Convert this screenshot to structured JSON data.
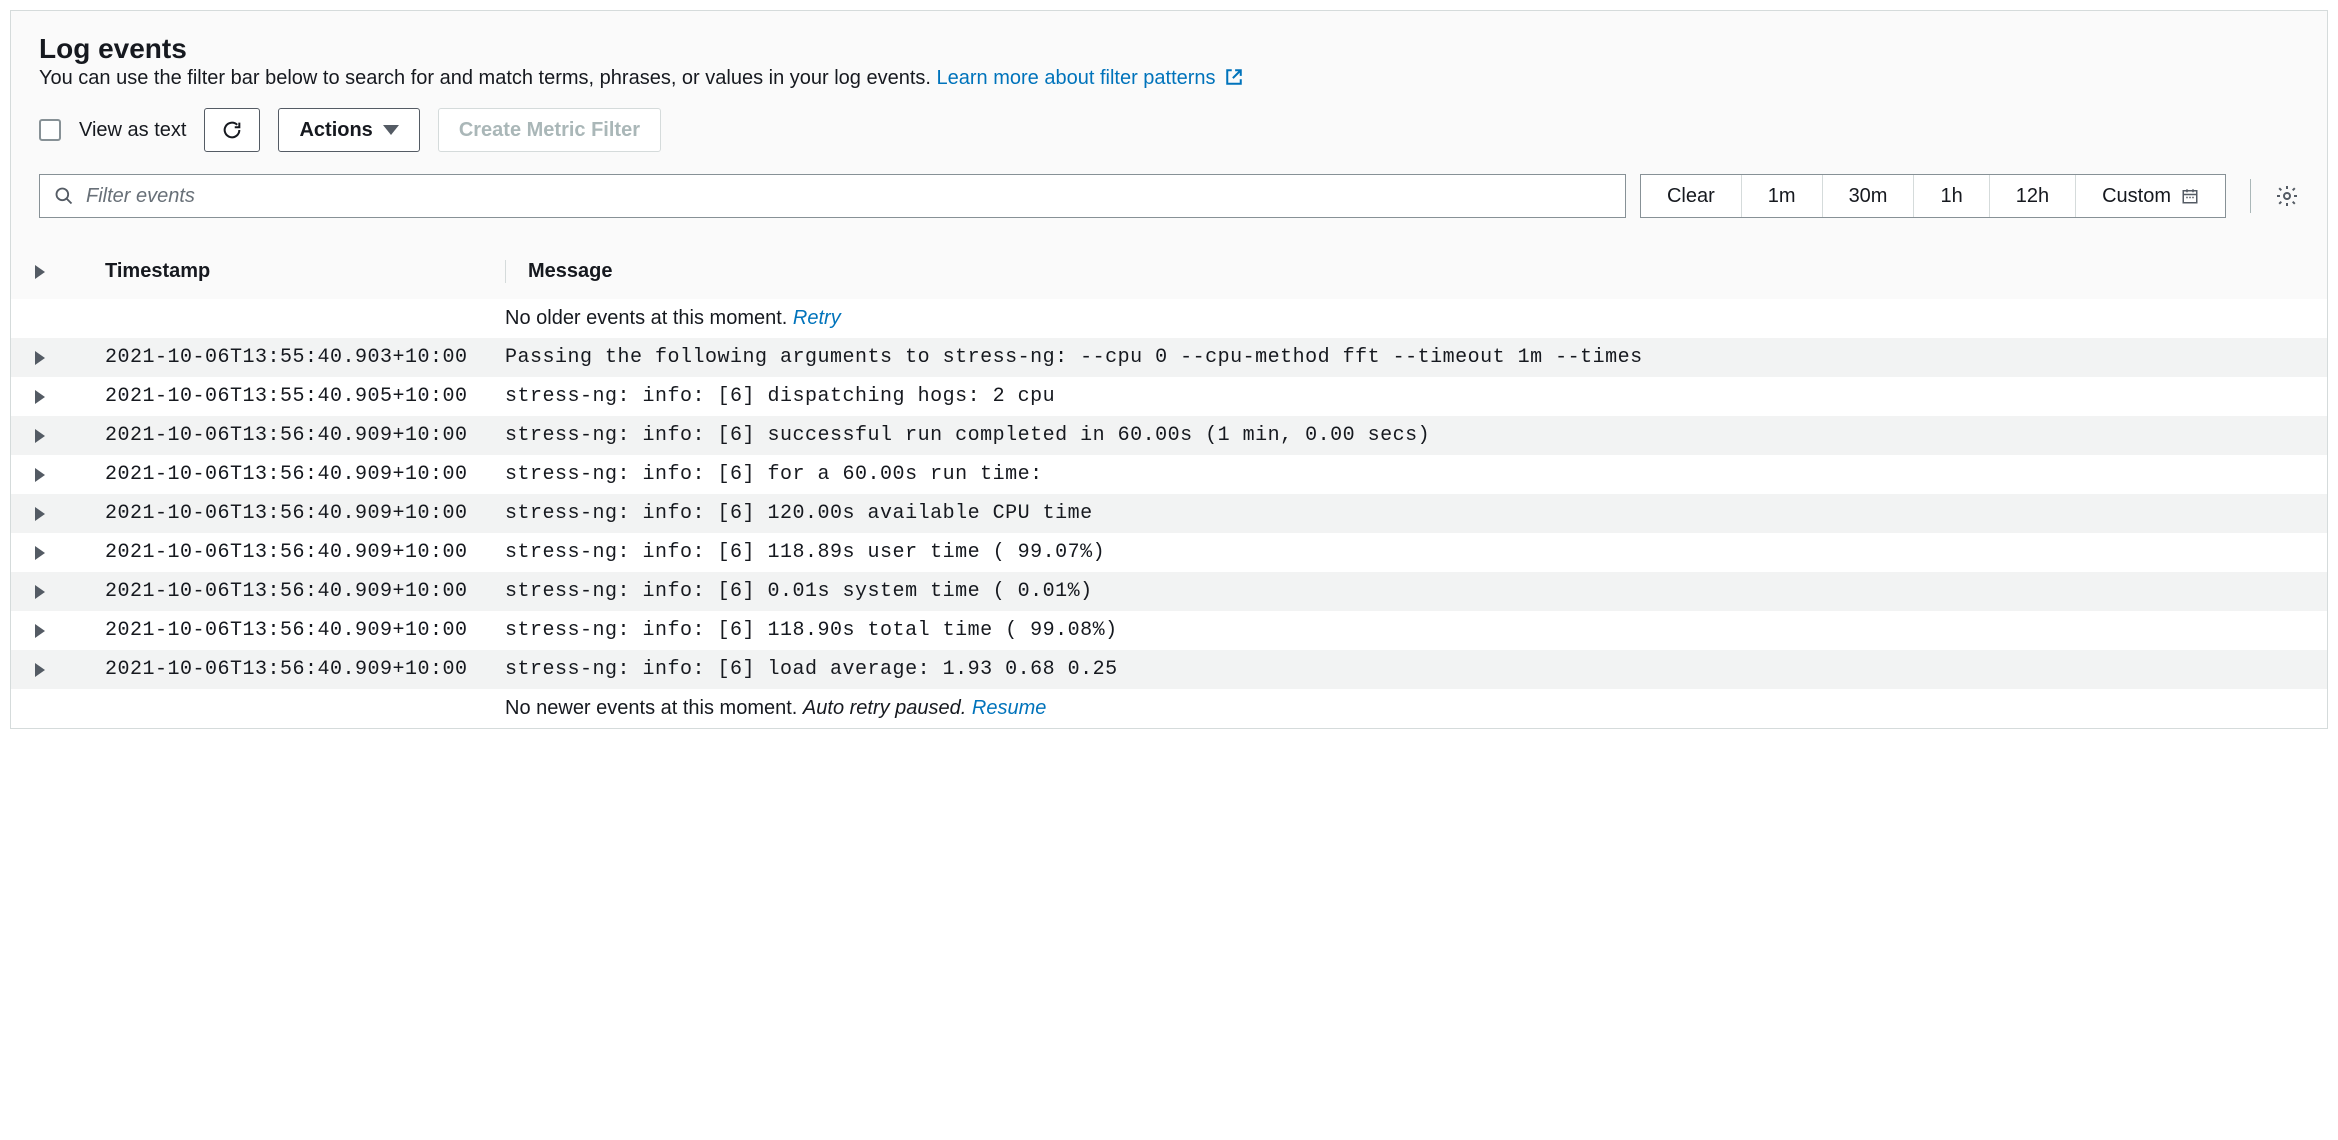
{
  "header": {
    "title": "Log events",
    "subtitle": "You can use the filter bar below to search for and match terms, phrases, or values in your log events.",
    "learn_more": "Learn more about filter patterns"
  },
  "toolbar": {
    "view_as_text": "View as text",
    "actions": "Actions",
    "create_filter": "Create Metric Filter"
  },
  "filter": {
    "placeholder": "Filter events",
    "clear": "Clear",
    "ranges": [
      "1m",
      "30m",
      "1h",
      "12h"
    ],
    "custom": "Custom"
  },
  "columns": {
    "timestamp": "Timestamp",
    "message": "Message"
  },
  "empty_top": {
    "text": "No older events at this moment.",
    "action": "Retry"
  },
  "empty_bottom": {
    "text": "No newer events at this moment.",
    "text2": "Auto retry paused.",
    "action": "Resume"
  },
  "rows": [
    {
      "ts": "2021-10-06T13:55:40.903+10:00",
      "msg": "Passing the following arguments to stress-ng: --cpu 0 --cpu-method fft --timeout 1m --times"
    },
    {
      "ts": "2021-10-06T13:55:40.905+10:00",
      "msg": "stress-ng: info: [6] dispatching hogs: 2 cpu"
    },
    {
      "ts": "2021-10-06T13:56:40.909+10:00",
      "msg": "stress-ng: info: [6] successful run completed in 60.00s (1 min, 0.00 secs)"
    },
    {
      "ts": "2021-10-06T13:56:40.909+10:00",
      "msg": "stress-ng: info: [6] for a 60.00s run time:"
    },
    {
      "ts": "2021-10-06T13:56:40.909+10:00",
      "msg": "stress-ng: info: [6] 120.00s available CPU time"
    },
    {
      "ts": "2021-10-06T13:56:40.909+10:00",
      "msg": "stress-ng: info: [6] 118.89s user time ( 99.07%)"
    },
    {
      "ts": "2021-10-06T13:56:40.909+10:00",
      "msg": "stress-ng: info: [6] 0.01s system time (  0.01%)"
    },
    {
      "ts": "2021-10-06T13:56:40.909+10:00",
      "msg": "stress-ng: info: [6] 118.90s total time ( 99.08%)"
    },
    {
      "ts": "2021-10-06T13:56:40.909+10:00",
      "msg": "stress-ng: info: [6] load average: 1.93 0.68 0.25"
    }
  ]
}
